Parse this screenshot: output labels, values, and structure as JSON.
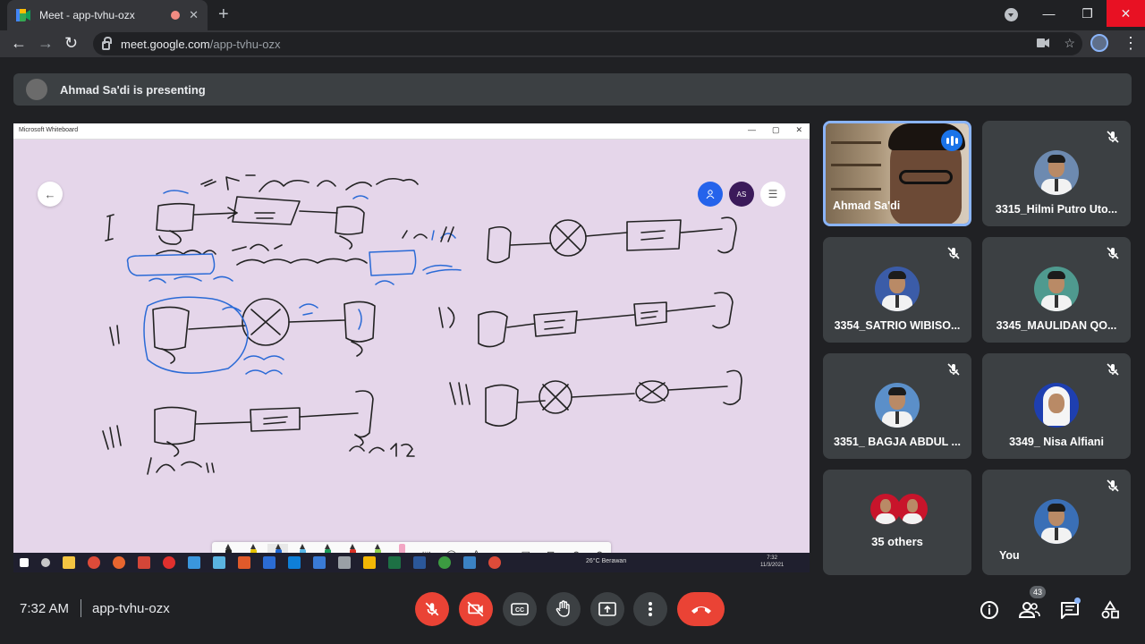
{
  "browser": {
    "tab_title": "Meet - app-tvhu-ozx",
    "url_host": "meet.google.com",
    "url_path": "/app-tvhu-ozx"
  },
  "banner": {
    "text": "Ahmad Sa'di is presenting"
  },
  "shared_screen": {
    "app_title": "Microsoft Whiteboard",
    "user_initials": "AS",
    "weather": "26°C Berawan",
    "clock_time": "7:32",
    "clock_date": "11/3/2021"
  },
  "participants": [
    {
      "name": "Ahmad Sa'di",
      "muted": false,
      "speaking": true
    },
    {
      "name": "3315_Hilmi Putro Uto...",
      "muted": true
    },
    {
      "name": "3354_SATRIO WIBISO...",
      "muted": true
    },
    {
      "name": "3345_MAULIDAN QO...",
      "muted": true
    },
    {
      "name": "3351_ BAGJA ABDUL ...",
      "muted": true
    },
    {
      "name": "3349_ Nisa Alfiani",
      "muted": true
    },
    {
      "name": "35 others",
      "muted": false
    },
    {
      "name": "You",
      "muted": true
    }
  ],
  "bottom_bar": {
    "time": "7:32 AM",
    "meeting_code": "app-tvhu-ozx",
    "people_count": "43"
  },
  "colors": {
    "accent": "#8ab4f8",
    "danger": "#ea4335",
    "surface": "#3c4043",
    "background": "#202124",
    "whiteboard": "#e5d6ea"
  }
}
